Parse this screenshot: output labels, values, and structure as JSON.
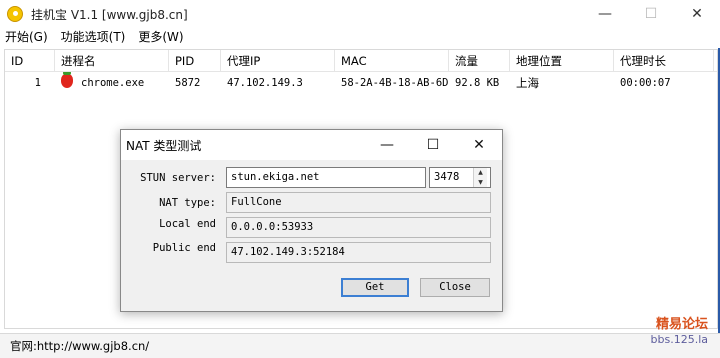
{
  "window": {
    "title": "挂机宝 V1.1  [www.gjb8.cn]",
    "minimize_glyph": "—",
    "restore_glyph": "☐",
    "close_glyph": "✕"
  },
  "menu": [
    "开始(G)",
    "功能选项(T)",
    "更多(W)"
  ],
  "table": {
    "columns": [
      "ID",
      "进程名",
      "PID",
      "代理IP",
      "MAC",
      "流量",
      "地理位置",
      "代理时长"
    ],
    "rows": [
      {
        "id": "1",
        "process": "chrome.exe",
        "pid": "5872",
        "proxy_ip": "47.102.149.3",
        "mac": "58-2A-4B-18-AB-6D",
        "traffic": "92.8 KB",
        "location": "上海",
        "duration": "00:00:07"
      }
    ]
  },
  "status": {
    "text": "官网:http://www.gjb8.cn/"
  },
  "watermark": {
    "top": "精易论坛",
    "bottom": "bbs.125.la"
  },
  "dialog": {
    "title": "NAT 类型测试",
    "minimize_glyph": "—",
    "maximize_glyph": "☐",
    "close_glyph": "✕",
    "stun_label": "STUN server:",
    "stun_value": "stun.ekiga.net",
    "port_value": "3478",
    "nat_type_label": "NAT type:",
    "nat_type_value": "FullCone",
    "local_end_label": "Local end",
    "local_end_value": "0.0.0.0:53933",
    "public_end_label": "Public end",
    "public_end_value": "47.102.149.3:52184",
    "get_label": "Get",
    "close_label": "Close"
  }
}
